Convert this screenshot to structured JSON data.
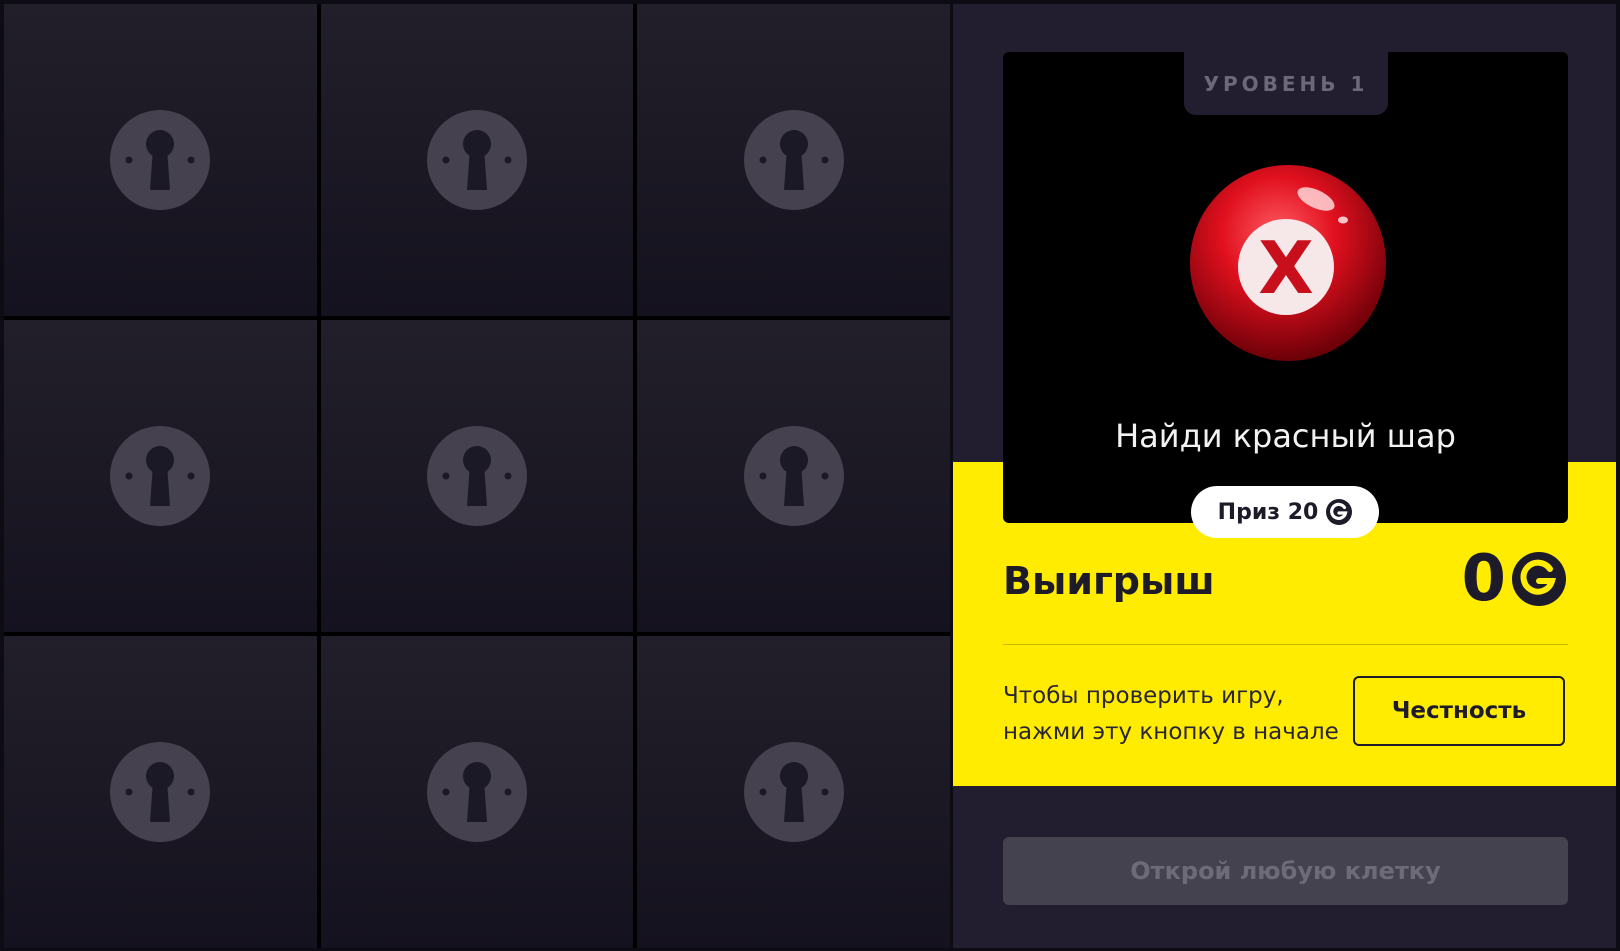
{
  "board": {
    "cells": [
      {
        "icon": "keyhole-icon"
      },
      {
        "icon": "keyhole-icon"
      },
      {
        "icon": "keyhole-icon"
      },
      {
        "icon": "keyhole-icon"
      },
      {
        "icon": "keyhole-icon"
      },
      {
        "icon": "keyhole-icon"
      },
      {
        "icon": "keyhole-icon"
      },
      {
        "icon": "keyhole-icon"
      },
      {
        "icon": "keyhole-icon"
      }
    ]
  },
  "level": {
    "tab_label": "УРОВЕНЬ 1",
    "ball_icon": "red-ball-x-icon",
    "instruction": "Найди красный шар",
    "prize_label": "Приз 20",
    "currency_icon": "coin-g-icon"
  },
  "winnings": {
    "label": "Выигрыш",
    "value": "0",
    "currency_icon": "coin-g-icon"
  },
  "fairness": {
    "text": "Чтобы проверить игру, нажми эту кнопку в начале",
    "button_label": "Честность"
  },
  "action": {
    "button_label": "Открой любую клетку"
  },
  "colors": {
    "accent_yellow": "#ffec00",
    "panel_bg": "#221e30",
    "cell_icon": "#45414f",
    "ball_red": "#e0101e"
  }
}
